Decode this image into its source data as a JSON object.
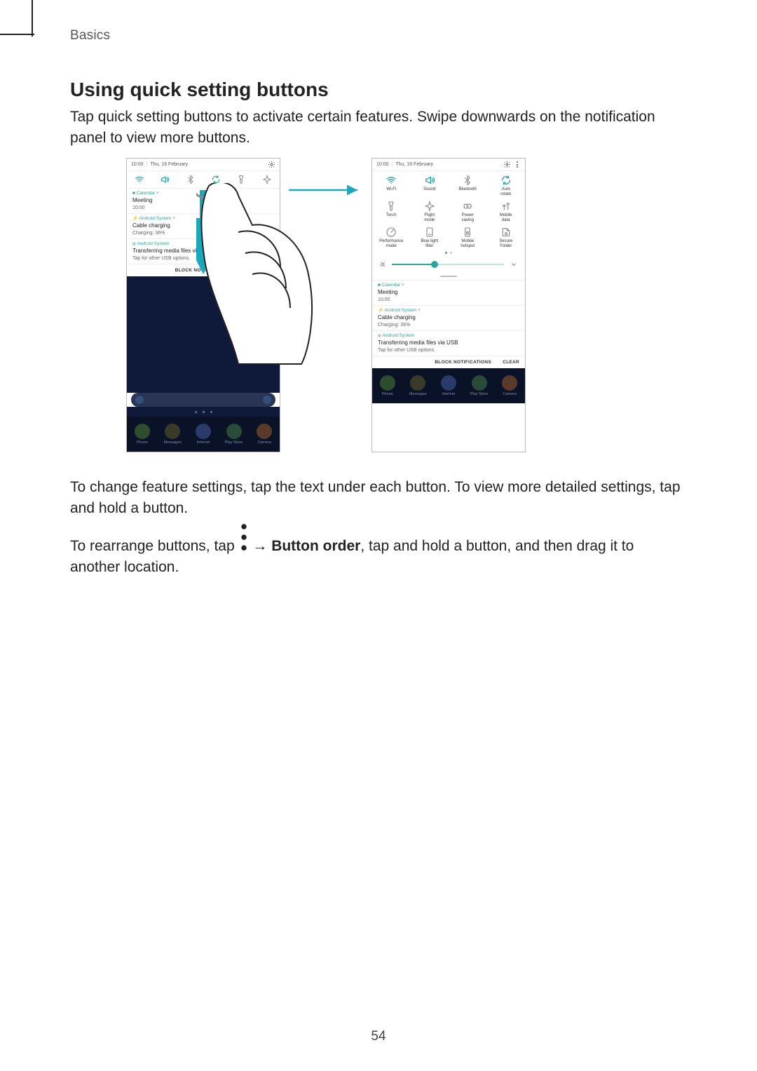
{
  "header": {
    "chapter": "Basics"
  },
  "heading": "Using quick setting buttons",
  "p1": "Tap quick setting buttons to activate certain features. Swipe downwards on the notification panel to view more buttons.",
  "p2": "To change feature settings, tap the text under each button. To view more detailed settings, tap and hold a button.",
  "p3a": "To rearrange buttons, tap ",
  "p3_arrow": "→",
  "p3_bold": "Button order",
  "p3b": ", tap and hold a button, and then drag it to another location.",
  "page_number": "54",
  "status": {
    "time": "10:00",
    "date": "Thu, 16 February"
  },
  "qs_row_icons_left": [
    "wifi",
    "sound",
    "bluetooth",
    "rotate",
    "torch",
    "flight"
  ],
  "notifs": {
    "calendar": {
      "app": "Calendar",
      "title": "Meeting",
      "sub": "10:00"
    },
    "charging": {
      "app": "Android System",
      "title": "Cable charging",
      "sub": "Charging: 36%"
    },
    "usb": {
      "app": "Android System",
      "title": "Transferring media files via USB",
      "sub": "Tap for other USB options."
    }
  },
  "block_left": "BLOCK NOTIFICATIONS",
  "block_right_a": "BLOCK NOTIFICATIONS",
  "block_right_b": "CLEAR",
  "qs_tiles": [
    [
      {
        "l": "Wi-Fi",
        "c": "teal",
        "i": "wifi"
      },
      {
        "l": "Sound",
        "c": "teal",
        "i": "sound"
      },
      {
        "l": "Bluetooth",
        "c": "gray",
        "i": "bluetooth"
      },
      {
        "l": "Auto\nrotate",
        "c": "teal",
        "i": "rotate"
      }
    ],
    [
      {
        "l": "Torch",
        "c": "gray",
        "i": "torch"
      },
      {
        "l": "Flight\nmode",
        "c": "gray",
        "i": "flight"
      },
      {
        "l": "Power\nsaving",
        "c": "gray",
        "i": "power"
      },
      {
        "l": "Mobile\ndata",
        "c": "gray",
        "i": "mobile"
      }
    ],
    [
      {
        "l": "Performance\nmode",
        "c": "gray",
        "i": "perf"
      },
      {
        "l": "Blue light\nfilter",
        "c": "gray",
        "i": "blue"
      },
      {
        "l": "Mobile\nhotspot",
        "c": "gray",
        "i": "hotspot"
      },
      {
        "l": "Secure\nFolder",
        "c": "gray",
        "i": "secure"
      }
    ]
  ],
  "dock": [
    {
      "l": "Phone",
      "k": "c-phone"
    },
    {
      "l": "Messages",
      "k": "c-msg"
    },
    {
      "l": "Internet",
      "k": "c-int"
    },
    {
      "l": "Play Store",
      "k": "c-play"
    },
    {
      "l": "Camera",
      "k": "c-cam"
    }
  ]
}
